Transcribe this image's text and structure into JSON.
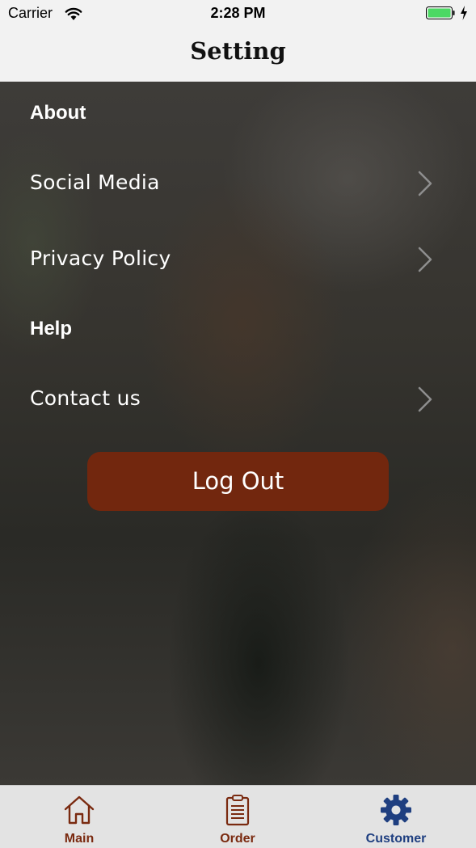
{
  "status_bar": {
    "carrier": "Carrier",
    "time": "2:28 PM",
    "battery_color": "#4cd964"
  },
  "nav": {
    "title": "Setting"
  },
  "sections": {
    "about": {
      "header": "About",
      "items": [
        {
          "label": "Social Media",
          "icon": "chevron-right-icon"
        },
        {
          "label": "Privacy Policy",
          "icon": "chevron-right-icon"
        }
      ]
    },
    "help": {
      "header": "Help",
      "items": [
        {
          "label": "Contact us",
          "icon": "chevron-right-icon"
        }
      ]
    }
  },
  "logout": {
    "label": "Log Out",
    "color": "#72270e"
  },
  "tab_bar": {
    "tabs": [
      {
        "label": "Main",
        "icon": "home-icon",
        "color": "#7a2a10",
        "selected": false
      },
      {
        "label": "Order",
        "icon": "clipboard-icon",
        "color": "#7a2a10",
        "selected": false
      },
      {
        "label": "Customer",
        "icon": "gear-icon",
        "color": "#1f3f80",
        "selected": true
      }
    ]
  }
}
